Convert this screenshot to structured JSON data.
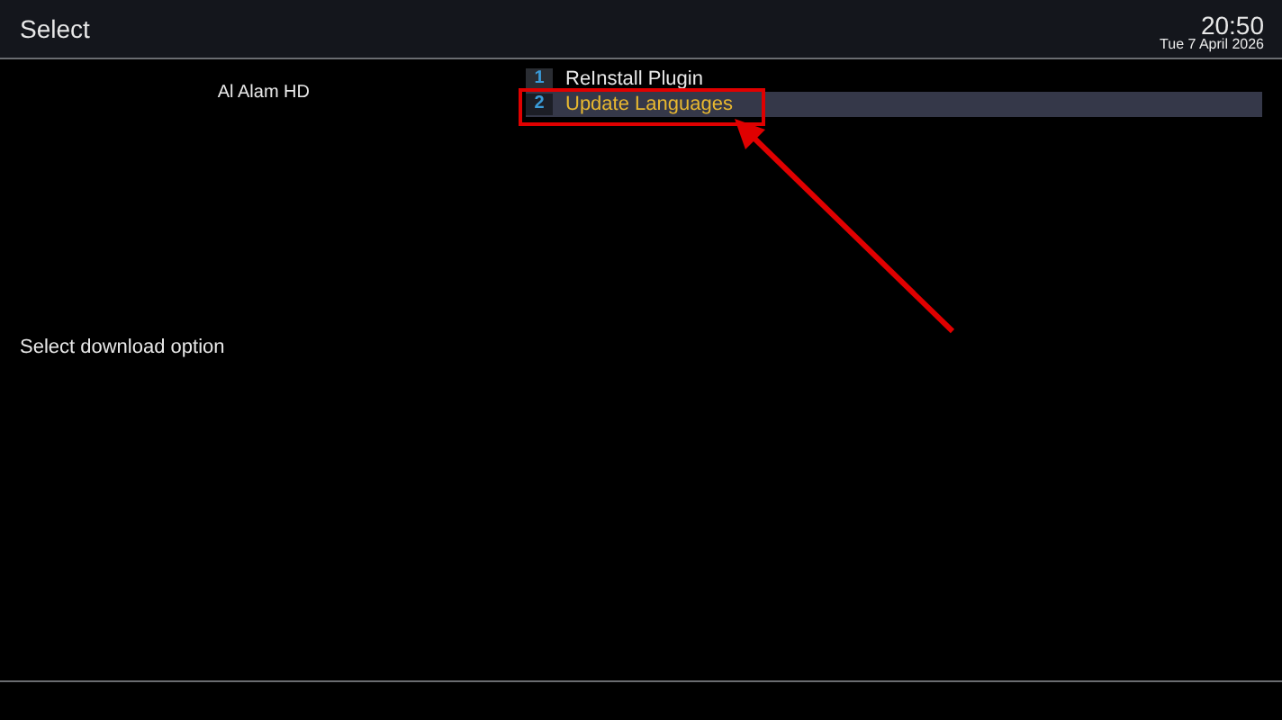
{
  "header": {
    "title": "Select",
    "time": "20:50",
    "date": "Tue 7 April 2026"
  },
  "channel": "Al Alam HD",
  "menu": [
    {
      "number": "1",
      "label": "ReInstall Plugin",
      "selected": false
    },
    {
      "number": "2",
      "label": "Update Languages",
      "selected": true
    }
  ],
  "prompt": "Select download option"
}
